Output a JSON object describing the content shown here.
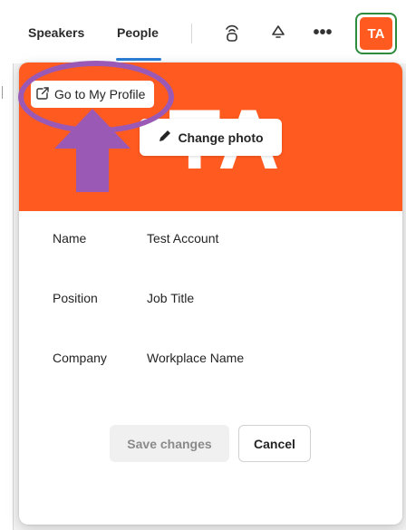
{
  "topbar": {
    "tabs": [
      {
        "label": "Speakers"
      },
      {
        "label": "People"
      }
    ],
    "more_label": "•••",
    "avatar_initials": "TA"
  },
  "profile": {
    "go_to_profile_label": "Go to My Profile",
    "banner_initials": "TA",
    "change_photo_label": "Change photo",
    "fields": [
      {
        "label": "Name",
        "value": "Test Account"
      },
      {
        "label": "Position",
        "value": "Job Title"
      },
      {
        "label": "Company",
        "value": "Workplace Name"
      }
    ],
    "save_label": "Save changes",
    "cancel_label": "Cancel"
  },
  "colors": {
    "accent": "#ff5a1f",
    "annotation": "#9b59b6",
    "focus_ring": "#2e8b3e",
    "tab_active": "#2c7fd6"
  },
  "icons": {
    "toolbar": [
      "broadcast-icon",
      "bell-icon",
      "more-icon"
    ],
    "profile": [
      "external-link-icon",
      "pencil-icon"
    ]
  }
}
